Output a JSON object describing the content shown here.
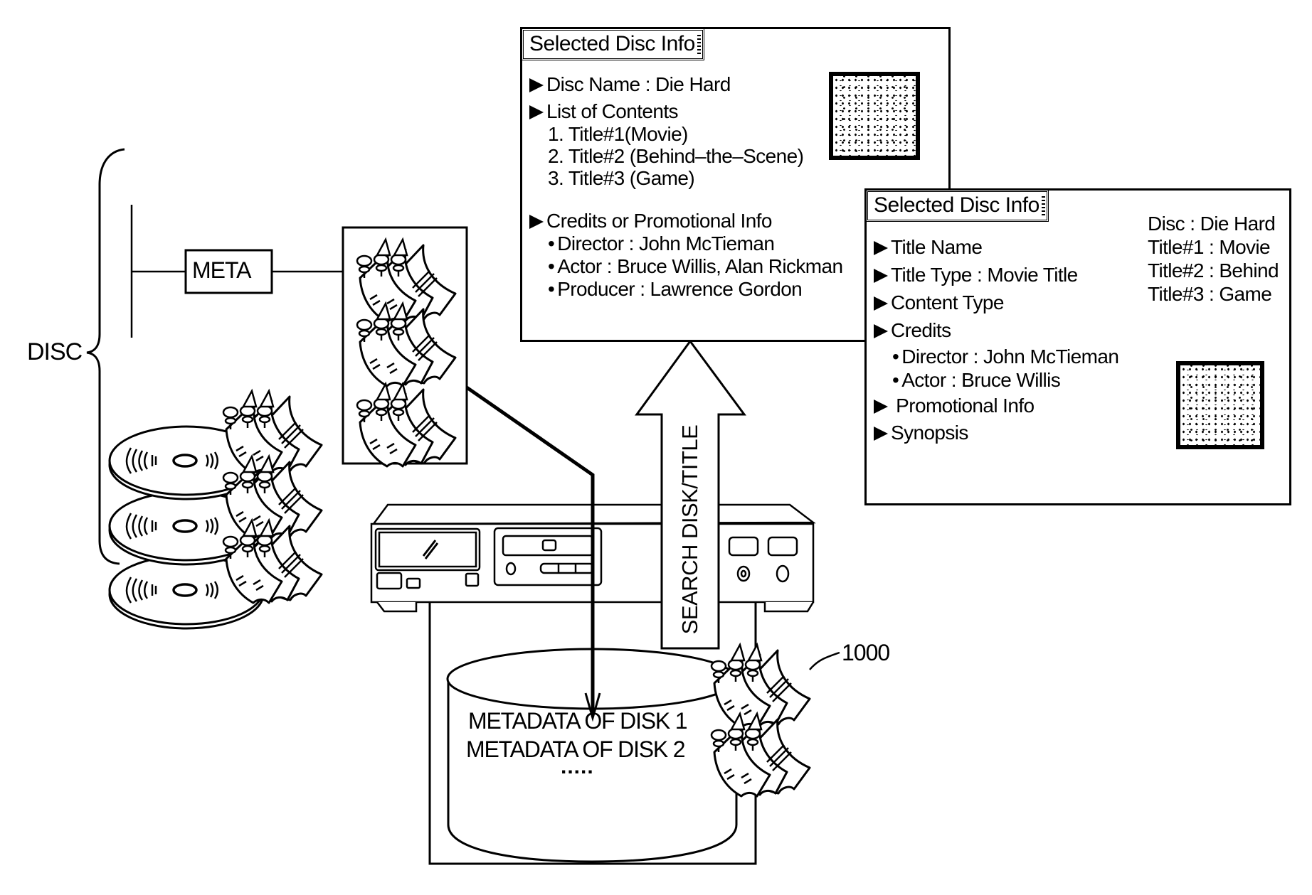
{
  "diagram": {
    "disc_group": {
      "label": "DISC",
      "meta_label": "META"
    },
    "panel_1": {
      "title": "Selected Disc Info",
      "items": [
        {
          "type": "heading",
          "text": "Disc Name : Die Hard"
        },
        {
          "type": "heading",
          "text": "List of Contents"
        },
        {
          "type": "sub",
          "text": "1. Title#1(Movie)"
        },
        {
          "type": "sub",
          "text": "2. Title#2 (Behind–the–Scene)"
        },
        {
          "type": "sub",
          "text": "3. Title#3 (Game)"
        },
        {
          "type": "heading",
          "text": "Credits or Promotional Info"
        },
        {
          "type": "bullet",
          "text": "Director : John McTieman"
        },
        {
          "type": "bullet",
          "text": "Actor : Bruce Willis, Alan Rickman"
        },
        {
          "type": "bullet",
          "text": "Producer : Lawrence Gordon"
        }
      ],
      "thumbnail": "cover-image"
    },
    "panel_2": {
      "title": "Selected Disc Info",
      "items": [
        {
          "type": "heading",
          "text": "Title Name"
        },
        {
          "type": "heading",
          "text": "Title Type : Movie Title"
        },
        {
          "type": "heading",
          "text": "Content Type"
        },
        {
          "type": "heading",
          "text": "Credits"
        },
        {
          "type": "bullet",
          "text": "Director : John McTieman"
        },
        {
          "type": "bullet",
          "text": "Actor : Bruce Willis"
        },
        {
          "type": "heading",
          "text": " Promotional Info"
        },
        {
          "type": "heading",
          "text": "Synopsis"
        }
      ],
      "summary": [
        "Disc : Die Hard",
        "Title#1 : Movie",
        "Title#2 : Behind",
        "Title#3 : Game"
      ],
      "thumbnail": "cover-image"
    },
    "search_arrow": {
      "label": "SEARCH DISK/TITLE"
    },
    "database": {
      "lines": [
        "METADATA OF DISK 1",
        "METADATA OF DISK 2",
        "....."
      ],
      "reference_numeral": "1000"
    },
    "icons": {
      "disc": "optical-disc-icon",
      "metadata_files": "pinned-document-stack-icon",
      "player": "disc-player-device-icon",
      "database": "database-cylinder-icon"
    }
  }
}
